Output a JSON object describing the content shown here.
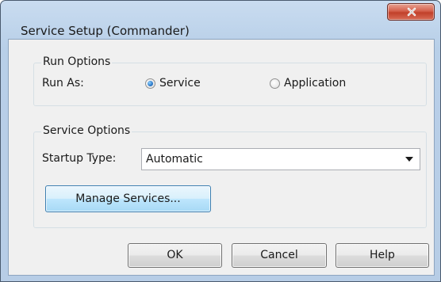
{
  "window": {
    "title": "Service Setup (Commander)"
  },
  "run_options": {
    "legend": "Run Options",
    "run_as_label": "Run As:",
    "options": [
      {
        "label": "Service",
        "selected": true
      },
      {
        "label": "Application",
        "selected": false
      }
    ]
  },
  "service_options": {
    "legend": "Service Options",
    "startup_type_label": "Startup Type:",
    "startup_type_value": "Automatic",
    "manage_services_label": "Manage Services..."
  },
  "footer": {
    "ok_label": "OK",
    "cancel_label": "Cancel",
    "help_label": "Help"
  },
  "icons": {
    "close": "close-icon",
    "dropdown": "chevron-down-icon"
  },
  "colors": {
    "close_button": "#c7432d",
    "focus_button": "#3c7fb1",
    "radio_selected": "#2b79c8"
  }
}
